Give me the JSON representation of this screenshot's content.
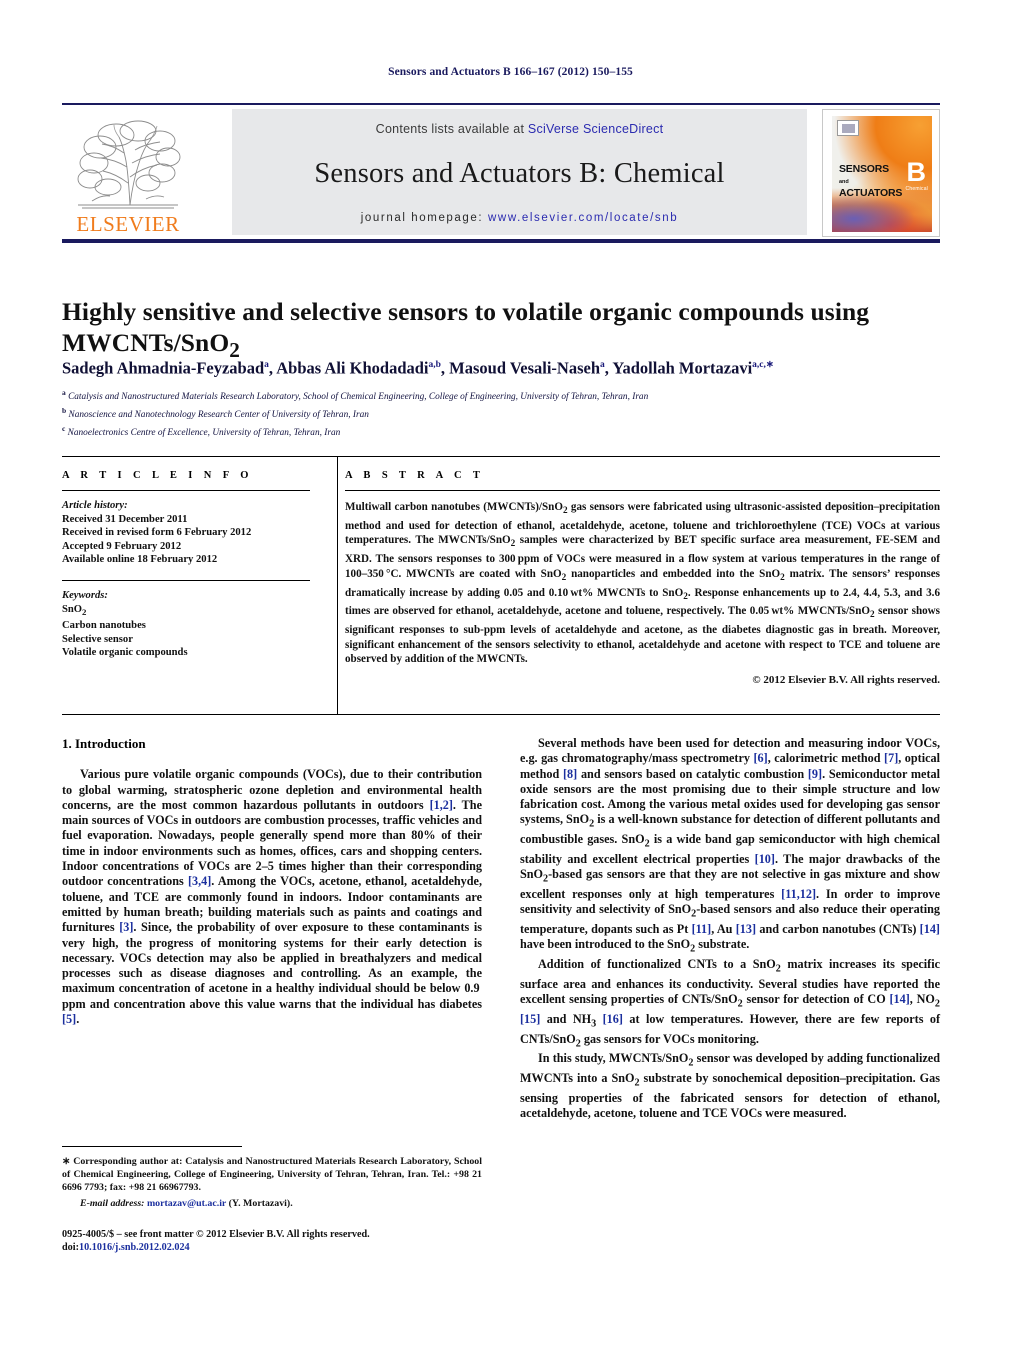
{
  "running_head": "Sensors and Actuators B 166–167 (2012) 150–155",
  "banner": {
    "publisher_name": "ELSEVIER",
    "contents_prefix": "Contents lists available at ",
    "contents_link": "SciVerse ScienceDirect",
    "journal_title": "Sensors and Actuators B: Chemical",
    "homepage_label": "journal homepage:",
    "homepage_url": "www.elsevier.com/locate/snb",
    "cover": {
      "line1": "SENSORS",
      "line1_small": "and",
      "line2": "ACTUATORS",
      "series_letter": "B",
      "series_sub": "Chemical"
    }
  },
  "article": {
    "title": "Highly sensitive and selective sensors to volatile organic compounds using MWCNTs/SnO",
    "title_sub": "2",
    "authors_html": "Sadegh Ahmadnia-Feyzabad<sup>a</sup>, Abbas Ali Khodadadi<sup>a,b</sup>, Masoud Vesali-Naseh<sup>a</sup>, Yadollah Mortazavi<sup>a,c,</sup><sup>∗</sup>",
    "affiliations": [
      {
        "marker": "a",
        "text": "Catalysis and Nanostructured Materials Research Laboratory, School of Chemical Engineering, College of Engineering, University of Tehran, Tehran, Iran"
      },
      {
        "marker": "b",
        "text": "Nanoscience and Nanotechnology Research Center of University of Tehran, Iran"
      },
      {
        "marker": "c",
        "text": "Nanoelectronics Centre of Excellence, University of Tehran, Tehran, Iran"
      }
    ]
  },
  "article_info": {
    "heading": "A R T I C L E   I N F O",
    "history_label": "Article history:",
    "history": [
      "Received 31 December 2011",
      "Received in revised form 6 February 2012",
      "Accepted 9 February 2012",
      "Available online 18 February 2012"
    ],
    "keywords_label": "Keywords:",
    "keywords": [
      "SnO2",
      "Carbon nanotubes",
      "Selective sensor",
      "Volatile organic compounds"
    ]
  },
  "abstract": {
    "heading": "A B S T R A C T",
    "body_html": "Multiwall carbon nanotubes (MWCNTs)/SnO<sub>2</sub> gas sensors were fabricated using ultrasonic-assisted deposition&ndash;precipitation method and used for detection of ethanol, acetaldehyde, acetone, toluene and trichloroethylene (TCE) VOCs at various temperatures. The MWCNTs/SnO<sub>2</sub> samples were characterized by BET specific surface area measurement, FE-SEM and XRD. The sensors responses to 300&thinsp;ppm of VOCs were measured in a flow system at various temperatures in the range of 100&ndash;350&thinsp;&deg;C. MWCNTs are coated with SnO<sub>2</sub> nanoparticles and embedded into the SnO<sub>2</sub> matrix. The sensors&rsquo; responses dramatically increase by adding 0.05 and 0.10&thinsp;wt% MWCNTs to SnO<sub>2</sub>. Response enhancements up to 2.4, 4.4, 5.3, and 3.6 times are observed for ethanol, acetaldehyde, acetone and toluene, respectively. The 0.05&thinsp;wt% MWCNTs/SnO<sub>2</sub> sensor shows significant responses to sub-ppm levels of acetaldehyde and acetone, as the diabetes diagnostic gas in breath. Moreover, significant enhancement of the sensors selectivity to ethanol, acetaldehyde and acetone with respect to TCE and toluene are observed by addition of the MWCNTs.",
    "copyright": "© 2012 Elsevier B.V. All rights reserved."
  },
  "sections": {
    "intro_heading": "1.  Introduction",
    "left_paragraphs_html": [
      "Various pure volatile organic compounds (VOCs), due to their contribution to global warming, stratospheric ozone depletion and environmental health concerns, are the most common hazardous pollutants in outdoors <span class=\"ref\">[1,2]</span>. The main sources of VOCs in outdoors are combustion processes, traffic vehicles and fuel evaporation. Nowadays, people generally spend more than 80% of their time in indoor environments such as homes, offices, cars and shopping centers. Indoor concentrations of VOCs are 2&ndash;5 times higher than their corresponding outdoor concentrations <span class=\"ref\">[3,4]</span>. Among the VOCs, acetone, ethanol, acetaldehyde, toluene, and TCE are commonly found in indoors. Indoor contaminants are emitted by human breath; building materials such as paints and coatings and furnitures <span class=\"ref\">[3]</span>. Since, the probability of over exposure to these contaminants is very high, the progress of monitoring systems for their early detection is necessary. VOCs detection may also be applied in breathalyzers and medical processes such as disease diagnoses and controlling. As an example, the maximum concentration of acetone in a healthy individual should be below 0.9&thinsp;ppm and concentration above this value warns that the individual has diabetes <span class=\"ref\">[5]</span>."
    ],
    "right_paragraphs_html": [
      "Several methods have been used for detection and measuring indoor VOCs, e.g. gas chromatography/mass spectrometry <span class=\"ref\">[6]</span>, calorimetric method <span class=\"ref\">[7]</span>, optical method <span class=\"ref\">[8]</span> and sensors based on catalytic combustion <span class=\"ref\">[9]</span>. Semiconductor metal oxide sensors are the most promising due to their simple structure and low fabrication cost. Among the various metal oxides used for developing gas sensor systems, SnO<sub>2</sub> is a well-known substance for detection of different pollutants and combustible gases. SnO<sub>2</sub> is a wide band gap semiconductor with high chemical stability and excellent electrical properties <span class=\"ref\">[10]</span>. The major drawbacks of the SnO<sub>2</sub>-based gas sensors are that they are not selective in gas mixture and show excellent responses only at high temperatures <span class=\"ref\">[11,12]</span>. In order to improve sensitivity and selectivity of SnO<sub>2</sub>-based sensors and also reduce their operating temperature, dopants such as Pt <span class=\"ref\">[11]</span>, Au <span class=\"ref\">[13]</span> and carbon nanotubes (CNTs) <span class=\"ref\">[14]</span> have been introduced to the SnO<sub>2</sub> substrate.",
      "Addition of functionalized CNTs to a SnO<sub>2</sub> matrix increases its specific surface area and enhances its conductivity. Several studies have reported the excellent sensing properties of CNTs/SnO<sub>2</sub> sensor for detection of CO <span class=\"ref\">[14]</span>, NO<sub>2</sub> <span class=\"ref\">[15]</span> and NH<sub>3</sub> <span class=\"ref\">[16]</span> at low temperatures. However, there are few reports of CNTs/SnO<sub>2</sub> gas sensors for VOCs monitoring.",
      "In this study, MWCNTs/SnO<sub>2</sub> sensor was developed by adding functionalized MWCNTs into a SnO<sub>2</sub> substrate by sonochemical deposition&ndash;precipitation. Gas sensing properties of the fabricated sensors for detection of ethanol, acetaldehyde, acetone, toluene and TCE VOCs were measured."
    ]
  },
  "footnote": {
    "corresponding_html": "<span class=\"star\">∗</span> Corresponding author at: Catalysis and Nanostructured Materials Research Laboratory, School of Chemical Engineering, College of Engineering, University of Tehran, Tehran, Iran. Tel.: +98 21 6696 7793; fax: +98 21 66967793.",
    "email_label": "E-mail address:",
    "email": "mortazav@ut.ac.ir",
    "email_owner": "(Y. Mortazavi)."
  },
  "imprint": {
    "issn_line": "0925-4005/$ – see front matter © 2012 Elsevier B.V. All rights reserved.",
    "doi_label": "doi:",
    "doi": "10.1016/j.snb.2012.02.024"
  },
  "colors": {
    "accent_orange": "#f07c1d",
    "link_blue": "#2b2bb0",
    "ref_blue": "#1b2f9e",
    "header_navy": "#1a1a5e",
    "banner_grey": "#e7e8ea"
  }
}
